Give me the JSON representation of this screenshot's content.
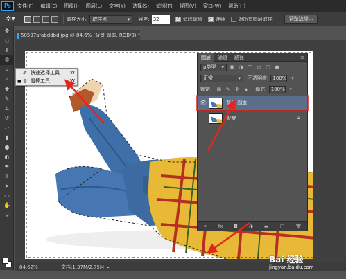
{
  "app": {
    "logo": "Ps"
  },
  "menubar": {
    "items": [
      "文件(F)",
      "编辑(E)",
      "图像(I)",
      "图层(L)",
      "文字(Y)",
      "选择(S)",
      "滤镜(T)",
      "视图(V)",
      "窗口(W)",
      "帮助(H)"
    ]
  },
  "options": {
    "sample_size_label": "取样大小:",
    "sample_size_value": "取样点",
    "tolerance_label": "容差:",
    "tolerance_value": "32",
    "antialias_label": "消除锯齿",
    "antialias_checked": true,
    "contiguous_label": "连续",
    "contiguous_checked": true,
    "all_layers_label": "对所有图层取样",
    "all_layers_checked": false,
    "refine_edge_button": "调整边缘..."
  },
  "document": {
    "tab_title": "50597afabddbd.jpg @ 84.6% (背景 副本, RGB/8) *"
  },
  "flyout": {
    "items": [
      {
        "icon": "quick-select-icon",
        "label": "快速选择工具",
        "shortcut": "W",
        "active": false
      },
      {
        "icon": "magic-wand-icon",
        "label": "魔棒工具",
        "shortcut": "W",
        "active": true
      }
    ]
  },
  "layers_panel": {
    "tabs": [
      "图层",
      "通道",
      "路径"
    ],
    "kind_filter": "ρ类型",
    "blend_mode": "正常",
    "opacity_label": "不透明度:",
    "opacity_value": "100%",
    "lock_label": "锁定:",
    "fill_label": "填充:",
    "fill_value": "100%",
    "layers": [
      {
        "name": "背景 副本",
        "visible": true,
        "selected": true,
        "locked": false
      },
      {
        "name": "背景",
        "visible": false,
        "selected": false,
        "locked": true
      }
    ]
  },
  "statusbar": {
    "zoom": "84.62%",
    "doc_info": "文档:1.37M/2.75M"
  },
  "watermark": {
    "main": "Bai 经验",
    "sub": "jingyan.baidu.com"
  },
  "colors": {
    "annotation_red": "#e3251f",
    "selection_highlight": "#5c6f8a"
  }
}
